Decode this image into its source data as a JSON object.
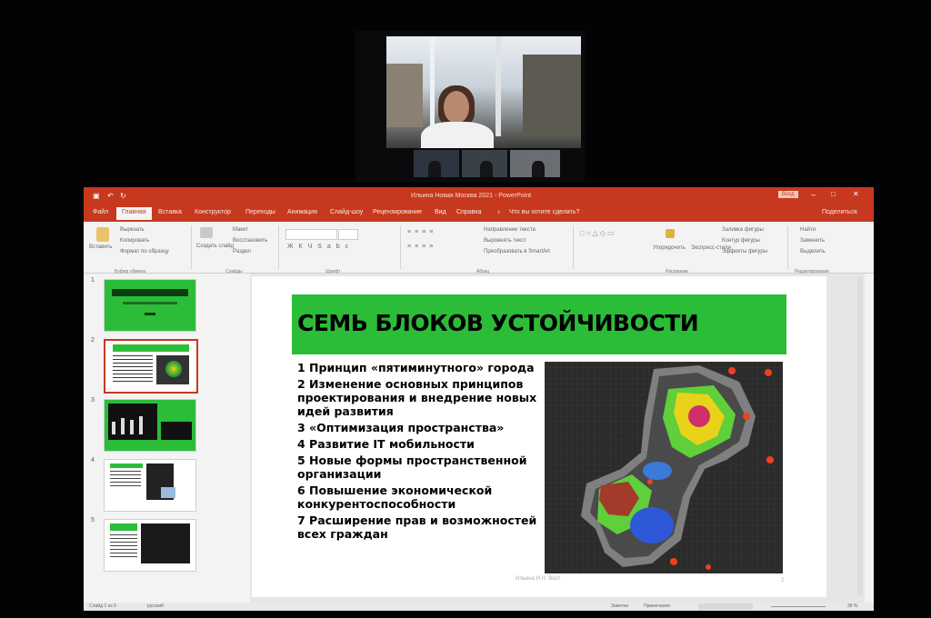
{
  "window": {
    "title": "Ильина Новая Москва 2021  -  PowerPoint",
    "login_label": "Вход",
    "share_label": "Поделиться"
  },
  "tabs": [
    "Файл",
    "Главная",
    "Вставка",
    "Конструктор",
    "Переходы",
    "Анимация",
    "Слайд-шоу",
    "Рецензирование",
    "Вид",
    "Справка",
    "Что вы хотите сделать?"
  ],
  "ribbon": {
    "paste": "Вставить",
    "cut": "Вырезать",
    "copy": "Копировать",
    "format_painter": "Формат по образцу",
    "clipboard_group": "Буфер обмена",
    "new_slide": "Создать слайд",
    "layout": "Макет",
    "reset": "Восстановить",
    "section": "Раздел",
    "slides_group": "Слайды",
    "font_group": "Шрифт",
    "text_direction": "Направление текста",
    "align_text": "Выровнять текст",
    "smartart": "Преобразовать в SmartArt",
    "paragraph_group": "Абзац",
    "arrange": "Упорядочить",
    "quick_styles": "Экспресс-стили",
    "shape_fill": "Заливка фигуры",
    "shape_outline": "Контур фигуры",
    "shape_effects": "Эффекты фигуры",
    "drawing_group": "Рисование",
    "find": "Найти",
    "replace": "Заменить",
    "select": "Выделить",
    "editing_group": "Редактирование"
  },
  "thumbnails": [
    {
      "num": "1",
      "theme": "green"
    },
    {
      "num": "2",
      "theme": "white-green",
      "selected": true
    },
    {
      "num": "3",
      "theme": "green-chart"
    },
    {
      "num": "4",
      "theme": "white-map"
    },
    {
      "num": "5",
      "theme": "green-map"
    }
  ],
  "slide": {
    "title": "СЕМЬ БЛОКОВ УСТОЙЧИВОСТИ",
    "bullets": [
      "1 Принцип «пятиминутного» города",
      "2 Изменение основных принципов проектирования и внедрение новых идей развития",
      "3 «Оптимизация пространства»",
      "4 Развитие IT мобильности",
      "5 Новые формы пространственной организации",
      "6 Повышение экономической конкурентоспособности",
      "7 Расширение прав и возможностей всех граждан"
    ],
    "footer": "Ильина И.Н. ВШУ",
    "page_number": "2"
  },
  "status": {
    "slide_counter": "Слайд 2 из 9",
    "language": "русский",
    "notes": "Заметки",
    "comments": "Примечания",
    "zoom": "38 %"
  },
  "colors": {
    "ppt_accent": "#c6391e",
    "slide_green": "#2bbd38"
  }
}
